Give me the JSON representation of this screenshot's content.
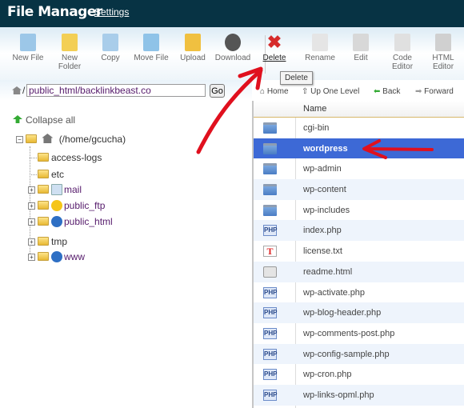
{
  "header": {
    "title": "File Manager",
    "settings": "Settings"
  },
  "toolbar": [
    {
      "label": "New File",
      "icon": "new-file-icon",
      "color": "#9cc7e8"
    },
    {
      "label": "New\nFolder",
      "icon": "new-folder-icon",
      "color": "#f3cf55"
    },
    {
      "label": "Copy",
      "icon": "copy-icon",
      "color": "#a9cdea"
    },
    {
      "label": "Move File",
      "icon": "move-file-icon",
      "color": "#8fc3e8"
    },
    {
      "label": "Upload",
      "icon": "upload-icon",
      "color": "#f0c040"
    },
    {
      "label": "Download",
      "icon": "download-icon",
      "color": "#555555"
    },
    {
      "label": "Delete",
      "icon": "delete-icon",
      "color": "#d62b2b"
    },
    {
      "label": "Rename",
      "icon": "rename-icon",
      "color": "#e5e5e5"
    },
    {
      "label": "Edit",
      "icon": "edit-icon",
      "color": "#d8d8d8"
    },
    {
      "label": "Code\nEditor",
      "icon": "code-editor-icon",
      "color": "#e0e0e0"
    },
    {
      "label": "HTML\nEditor",
      "icon": "html-editor-icon",
      "color": "#d0d0d0"
    }
  ],
  "tooltip": "Delete",
  "path": {
    "value": "public_html/backlinkbeast.co",
    "separator": "/",
    "go": "Go"
  },
  "nav": {
    "home": "Home",
    "up": "Up One Level",
    "back": "Back",
    "forward": "Forward"
  },
  "tree": {
    "collapse": "Collapse all",
    "root": "(/home/gcucha)",
    "items": [
      {
        "name": "access-logs",
        "expand": false,
        "badge": null
      },
      {
        "name": "etc",
        "expand": false,
        "badge": null
      },
      {
        "name": "mail",
        "expand": true,
        "badge": "mail-icon"
      },
      {
        "name": "public_ftp",
        "expand": true,
        "badge": "ftp-icon"
      },
      {
        "name": "public_html",
        "expand": true,
        "badge": "globe-icon"
      },
      {
        "name": "tmp",
        "expand": true,
        "badge": null
      },
      {
        "name": "www",
        "expand": true,
        "badge": "globe-icon"
      }
    ]
  },
  "list": {
    "header": "Name",
    "selected": "wordpress",
    "files": [
      {
        "name": "cgi-bin",
        "type": "folder"
      },
      {
        "name": "wordpress",
        "type": "folder"
      },
      {
        "name": "wp-admin",
        "type": "folder"
      },
      {
        "name": "wp-content",
        "type": "folder"
      },
      {
        "name": "wp-includes",
        "type": "folder"
      },
      {
        "name": "index.php",
        "type": "php"
      },
      {
        "name": "license.txt",
        "type": "txt"
      },
      {
        "name": "readme.html",
        "type": "html"
      },
      {
        "name": "wp-activate.php",
        "type": "php"
      },
      {
        "name": "wp-blog-header.php",
        "type": "php"
      },
      {
        "name": "wp-comments-post.php",
        "type": "php"
      },
      {
        "name": "wp-config-sample.php",
        "type": "php"
      },
      {
        "name": "wp-cron.php",
        "type": "php"
      },
      {
        "name": "wp-links-opml.php",
        "type": "php"
      }
    ]
  },
  "colors": {
    "header": "#073344",
    "selection": "#3d69d6",
    "annotation": "#e0101e"
  }
}
